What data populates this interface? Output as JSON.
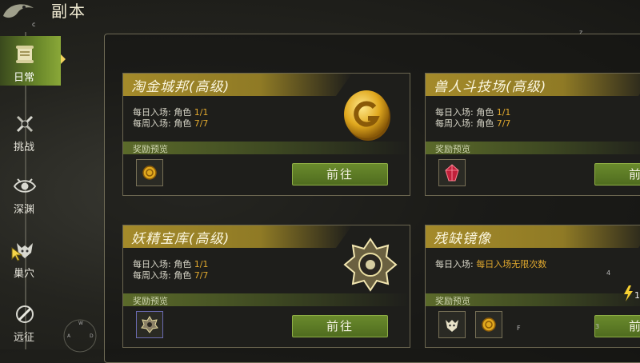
{
  "header": {
    "title": "副本",
    "corner_letter": "c",
    "right_letter": "z"
  },
  "sidebar": {
    "items": [
      {
        "label": "日常",
        "icon": "scroll-icon",
        "active": true
      },
      {
        "label": "挑战",
        "icon": "swords-icon",
        "active": false
      },
      {
        "label": "深渊",
        "icon": "eye-icon",
        "active": false
      },
      {
        "label": "巢穴",
        "icon": "beast-icon",
        "active": false
      },
      {
        "label": "远征",
        "icon": "sword-shield-icon",
        "active": false
      }
    ]
  },
  "cards": [
    {
      "title": "淘金城邦(高级)",
      "daily_label": "每日入场: 角色",
      "daily_value": "1/1",
      "weekly_label": "每周入场: 角色",
      "weekly_value": "7/7",
      "reward_label": "奖励预览",
      "rewards": [
        "gold-coin-icon"
      ],
      "button": "前往"
    },
    {
      "title": "兽人斗技场(高级)",
      "daily_label": "每日入场: 角色",
      "daily_value": "1/1",
      "weekly_label": "每周入场: 角色",
      "weekly_value": "7/7",
      "reward_label": "奖励预览",
      "rewards": [
        "red-gem-icon"
      ],
      "button": "前往"
    },
    {
      "title": "妖精宝库(高级)",
      "daily_label": "每日入场: 角色",
      "daily_value": "1/1",
      "weekly_label": "每周入场: 角色",
      "weekly_value": "7/7",
      "reward_label": "奖励预览",
      "rewards": [
        "gear-emblem-icon"
      ],
      "button": "前往"
    },
    {
      "title": "残缺镜像",
      "daily_label": "每日入场:",
      "daily_value": "每日入场无限次数",
      "reward_label": "奖励预览",
      "rewards": [
        "skull-emblem-icon",
        "gold-coin-icon"
      ],
      "button": "前往",
      "energy_value": "1"
    }
  ],
  "small_marks": {
    "m1": "4",
    "m2": "F",
    "m3": "3"
  },
  "colors": {
    "accent_gold": "#a48a2a",
    "button_green": "#5b7a24",
    "value_orange": "#e0a82e"
  }
}
